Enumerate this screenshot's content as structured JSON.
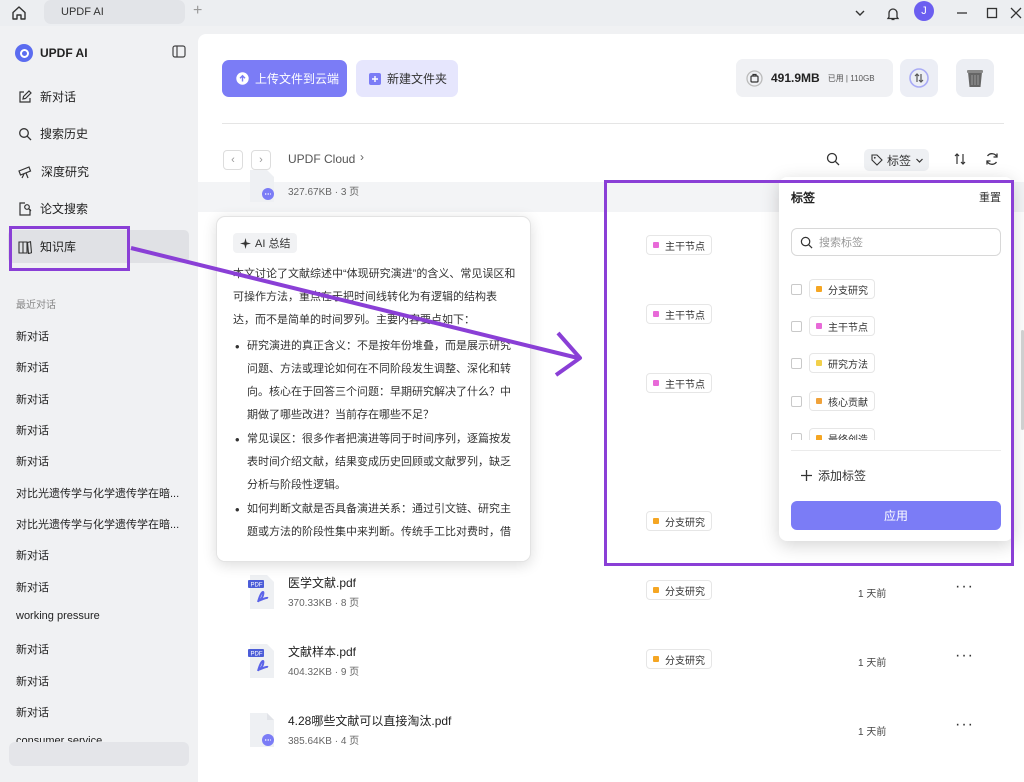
{
  "titlebar": {
    "tab_label": "UPDF AI",
    "avatar_initial": "J",
    "add_tab": "+"
  },
  "sidebar": {
    "brand": "UPDF AI",
    "nav": [
      {
        "label": "新对话"
      },
      {
        "label": "搜索历史"
      },
      {
        "label": "深度研究"
      },
      {
        "label": "论文搜索"
      },
      {
        "label": "知识库"
      }
    ],
    "section_label": "最近对话",
    "chats": [
      "新对话",
      "新对话",
      "新对话",
      "新对话",
      "新对话",
      "对比光遗传学与化学遗传学在暗...",
      "对比光遗传学与化学遗传学在暗...",
      "新对话",
      "新对话",
      "working pressure",
      "新对话",
      "新对话",
      "新对话",
      "consumer service"
    ]
  },
  "toolbar": {
    "upload_label": "上传文件到云端",
    "new_folder_label": "新建文件夹",
    "storage_used": "491.9MB",
    "storage_detail": "已用 | 110GB"
  },
  "breadcrumb": {
    "root": "UPDF Cloud",
    "chevron": "›"
  },
  "filters": {
    "tag_label": "标签"
  },
  "files": [
    {
      "meta": "327.67KB · 3 页"
    },
    {
      "name": "医学文献.pdf",
      "meta": "370.33KB · 8 页",
      "tag": "分支研究",
      "date": "1 天前"
    },
    {
      "name": "文献样本.pdf",
      "meta": "404.32KB · 9 页",
      "tag": "分支研究",
      "date": "1 天前"
    },
    {
      "name": "4.28哪些文献可以直接淘汰.pdf",
      "meta": "385.64KB · 4 页",
      "date": "1 天前"
    }
  ],
  "row_tags": [
    "主干节点",
    "主干节点",
    "主干节点",
    "分支研究"
  ],
  "ai_summary": {
    "badge": "AI 总结",
    "intro": "本文讨论了文献综述中“体现研究演进”的含义、常见误区和可操作方法，重点在于把时间线转化为有逻辑的结构表达，而不是简单的时间罗列。主要内容要点如下：",
    "points": [
      "研究演进的真正含义：不是按年份堆叠，而是展示研究问题、方法或理论如何在不同阶段发生调整、深化和转向。核心在于回答三个问题：早期研究解决了什么？中期做了哪些改进？当前存在哪些不足？",
      "常见误区：很多作者把演进等同于时间序列，逐篇按发表时间介绍文献，结果变成历史回顾或文献罗列，缺乏分析与阶段性逻辑。",
      "如何判断文献是否具备演进关系：通过引文链、研究主题或方法的阶段性集中来判断。传统手工比对费时，借"
    ]
  },
  "tag_panel": {
    "title": "标签",
    "reset": "重置",
    "search_placeholder": "搜索标签",
    "items": [
      {
        "label": "分支研究",
        "color": "#f5a623"
      },
      {
        "label": "主干节点",
        "color": "#e86ad8"
      },
      {
        "label": "研究方法",
        "color": "#f2d04a"
      },
      {
        "label": "核心贡献",
        "color": "#f0a23a"
      },
      {
        "label": "最终创造",
        "color": "#f5a623"
      }
    ],
    "add_label": "添加标签",
    "apply_label": "应用"
  },
  "colors": {
    "accent": "#7b7cf6",
    "highlight": "#8a3fd6",
    "tag_pink": "#e86ad8",
    "tag_orange": "#f5a623"
  }
}
